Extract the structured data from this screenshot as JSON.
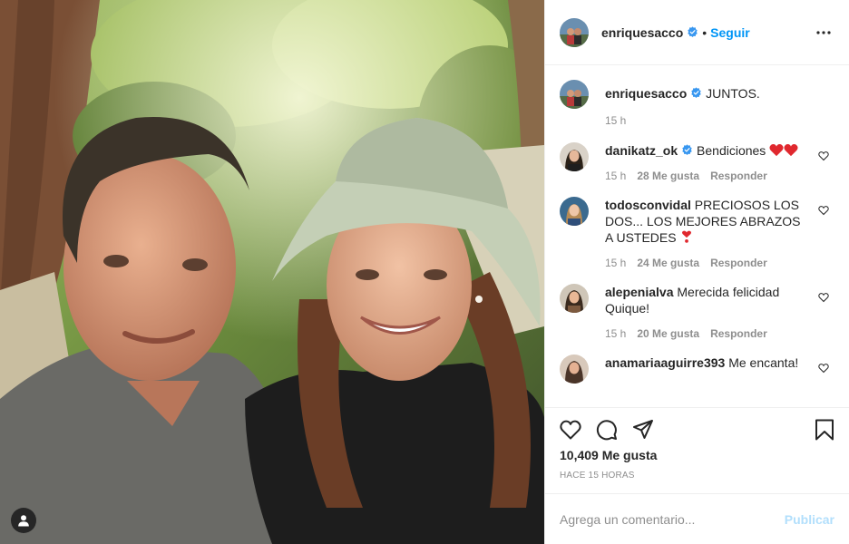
{
  "post": {
    "author": {
      "username": "enriquesacco",
      "verified": true,
      "follow_label": "Seguir",
      "separator": "•"
    },
    "caption": {
      "username": "enriquesacco",
      "text": "JUNTOS.",
      "time": "15 h"
    },
    "comments": [
      {
        "username": "danikatz_ok",
        "verified": true,
        "text": "Bendiciones",
        "emoji": [
          "red-heart",
          "red-heart"
        ],
        "time": "15 h",
        "likes": "28 Me gusta",
        "reply": "Responder"
      },
      {
        "username": "todosconvidal",
        "verified": false,
        "text": "PRECIOSOS LOS DOS... LOS MEJORES ABRAZOS A USTEDES",
        "emoji": [
          "heavy-heart-exclamation"
        ],
        "time": "15 h",
        "likes": "24 Me gusta",
        "reply": "Responder"
      },
      {
        "username": "alepenialva",
        "verified": false,
        "text": "Merecida felicidad Quique!",
        "emoji": [],
        "time": "15 h",
        "likes": "20 Me gusta",
        "reply": "Responder"
      },
      {
        "username": "anamariaaguirre393",
        "verified": false,
        "text": "Me encanta!",
        "emoji": [],
        "time": "",
        "likes": "",
        "reply": ""
      }
    ],
    "likes_count": "10,409 Me gusta",
    "time_ago": "HACE 15 HORAS",
    "add_comment": {
      "placeholder": "Agrega un comentario...",
      "post_label": "Publicar"
    },
    "icons": {
      "more": "more-horizontal-icon",
      "like": "heart-icon",
      "comment": "comment-icon",
      "share": "paper-plane-icon",
      "save": "bookmark-icon",
      "user_tag": "user-tag-icon"
    },
    "colors": {
      "link_blue": "#0095f6",
      "post_button_disabled": "#b2dffc",
      "verified_blue": "#3897f0",
      "secondary_text": "#8e8e8e"
    }
  }
}
